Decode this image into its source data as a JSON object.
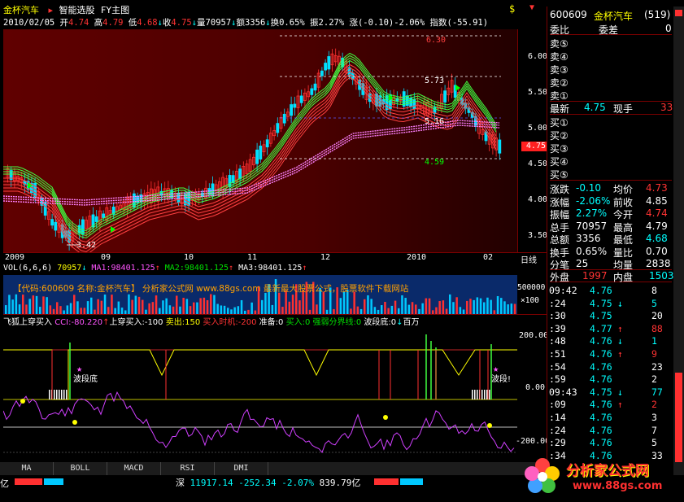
{
  "header": {
    "stock_name": "金杯汽车",
    "menu_smart": "智能选股",
    "menu_main": "FY主图",
    "date": "2010/02/05",
    "open_label": "开",
    "open": "4.74",
    "high_label": "高",
    "high": "4.79",
    "low_label": "低",
    "low": "4.68",
    "close_label": "收",
    "close": "4.75",
    "vol_label": "量",
    "vol": "70957",
    "amt_label": "额",
    "amt": "3356",
    "turn_label": "换",
    "turn": "0.65%",
    "amp_label": "振",
    "amp": "2.27%",
    "chg_label": "涨",
    "chg": "(-0.10)-2.06%",
    "index_label": "指数",
    "index": "(-55.91)",
    "icon_symbols": [
      "$",
      "▼"
    ]
  },
  "price_axis": [
    "6.00",
    "5.50",
    "5.00",
    "4.50",
    "4.00",
    "3.50"
  ],
  "price_marker": "4.75",
  "chart_labels": {
    "p630": "6.30",
    "p573": "5.73",
    "p516": "5.16",
    "p459": "4.59",
    "p342": "3.42"
  },
  "date_axis": [
    "2009",
    "09",
    "10",
    "11",
    "12",
    "2010",
    "02"
  ],
  "period_label": "日线",
  "volume": {
    "legend_label": "VOL(6,6,6)",
    "vol": "70957",
    "ma1": "MA1:98401.125",
    "ma2": "MA2:98401.125",
    "ma3": "MA3:98401.125",
    "ad_text": "【代码:600609 名称:金杯汽车】      分析家公式网 www.88gs.com 最新最大股票公式，股票软件下载网站",
    "axis": "500000",
    "axis_unit": "×100"
  },
  "indicator": {
    "name": "飞狐上穿买入",
    "cci": "CCI:-80.220",
    "cross_buy": "上穿买入:-100",
    "sell": "卖出:150",
    "buy_time": "买入时机:-200",
    "prepare": "准备:0",
    "buy": "买入:0",
    "boundary": "强弱分界线:0",
    "bottom": "波段底:0",
    "bai": "百万",
    "axis": [
      "200.00",
      "0.00",
      "-200.00"
    ],
    "label_bottom": "波段底",
    "label_bottom2": "波段!"
  },
  "tabs": [
    "MA",
    "BOLL",
    "MACD",
    "RSI",
    "DMI"
  ],
  "status": {
    "prefix": "亿",
    "market": "深",
    "index": "11917.14",
    "change": "-252.34",
    "pct": "-2.07%",
    "amount": "839.79亿"
  },
  "right_panel": {
    "code": "600609",
    "name": "金杯汽车",
    "no": "(519)",
    "weibi_label": "委比",
    "weicha_label": "委差",
    "weicha": "0",
    "sell_labels": [
      "卖⑤",
      "卖④",
      "卖③",
      "卖②",
      "卖①"
    ],
    "buy_labels": [
      "买①",
      "买②",
      "买③",
      "买④",
      "买⑤"
    ],
    "latest_label": "最新",
    "latest": "4.75",
    "vol_now_label": "现手",
    "vol_now": "33",
    "stats": [
      {
        "l1": "涨跌",
        "v1": "-0.10",
        "l2": "均价",
        "v2": "4.73"
      },
      {
        "l1": "涨幅",
        "v1": "-2.06%",
        "l2": "前收",
        "v2": "4.85"
      },
      {
        "l1": "振幅",
        "v1": "2.27%",
        "l2": "今开",
        "v2": "4.74"
      },
      {
        "l1": "总手",
        "v1": "70957",
        "l2": "最高",
        "v2": "4.79"
      },
      {
        "l1": "总额",
        "v1": "3356",
        "l2": "最低",
        "v2": "4.68"
      },
      {
        "l1": "换手",
        "v1": "0.65%",
        "l2": "量比",
        "v2": "0.70"
      },
      {
        "l1": "分笔",
        "v1": "25",
        "l2": "均量",
        "v2": "2838"
      }
    ],
    "outer_label": "外盘",
    "outer": "1997",
    "inner_label": "内盘",
    "inner": "1503",
    "trades": [
      {
        "t": "09:42",
        "p": "4.76",
        "a": "",
        "v": "8"
      },
      {
        "t": ":24",
        "p": "4.75",
        "a": "↓",
        "v": "5"
      },
      {
        "t": ":30",
        "p": "4.75",
        "a": "",
        "v": "20"
      },
      {
        "t": ":39",
        "p": "4.77",
        "a": "↑",
        "v": "88"
      },
      {
        "t": ":48",
        "p": "4.76",
        "a": "↓",
        "v": "1"
      },
      {
        "t": ":51",
        "p": "4.76",
        "a": "↑",
        "v": "9"
      },
      {
        "t": ":54",
        "p": "4.76",
        "a": "",
        "v": "23"
      },
      {
        "t": ":59",
        "p": "4.76",
        "a": "",
        "v": "2"
      },
      {
        "t": "09:43",
        "p": "4.75",
        "a": "↓",
        "v": "77"
      },
      {
        "t": ":09",
        "p": "4.76",
        "a": "↑",
        "v": "2"
      },
      {
        "t": ":14",
        "p": "4.76",
        "a": "",
        "v": "3"
      },
      {
        "t": ":24",
        "p": "4.76",
        "a": "",
        "v": "7"
      },
      {
        "t": ":29",
        "p": "4.76",
        "a": "",
        "v": "5"
      },
      {
        "t": ":34",
        "p": "4.76",
        "a": "",
        "v": "33"
      }
    ]
  },
  "watermark": {
    "title": "分析家公式网",
    "url": "www.88gs.com"
  },
  "colors": {
    "up": "#ff3333",
    "down": "#00ffff",
    "bg_main": "#6b0000",
    "label": "#ffff00"
  }
}
